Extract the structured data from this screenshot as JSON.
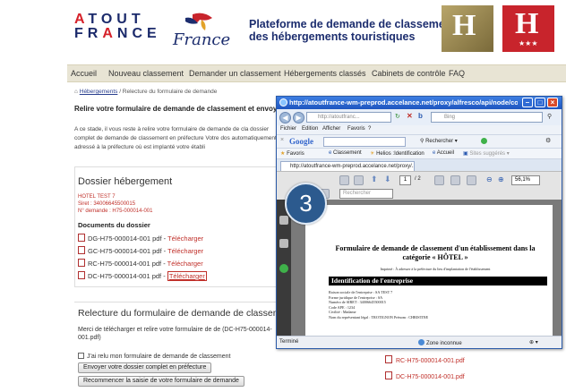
{
  "site": {
    "logo_line1_a": "A",
    "logo_line1_b": "TOUT",
    "logo_line2_a": "FR",
    "logo_line2_b": "A",
    "logo_line2_c": "NCE",
    "logo_script": "France",
    "title_line1": "Plateforme de demande de classement",
    "title_line2": "des hébergements touristiques",
    "badge_letter": "H",
    "badge_stars": "★★★"
  },
  "nav": {
    "items": [
      "Accueil",
      "Nouveau classement",
      "Demander un classement",
      "Hébergements classés",
      "Cabinets de contrôle",
      "FAQ"
    ]
  },
  "breadcrumb": {
    "link": "Hébergements",
    "rest": " / Relecture du formulaire de demande"
  },
  "main": {
    "heading": "Relire votre formulaire de demande de classement et envoyer",
    "intro": "A ce stade, il vous reste à relire votre formulaire de demande de cla dossier complet de demande de classement en préfecture Votre dos automatiquement adressé à la préfecture où est implanté votre établi"
  },
  "dossier": {
    "title": "Dossier hébergement",
    "hotel_name": "HOTEL TEST 7",
    "siret": "Siret : 34006645500015",
    "demande": "N° demande : H75-000014-001",
    "docs_title": "Documents du dossier",
    "documents": [
      {
        "name": "DG-H75-000014-001 pdf - ",
        "action": "Télécharger"
      },
      {
        "name": "GC-H75-000014-001 pdf - ",
        "action": "Télécharger"
      },
      {
        "name": "RC-H75-000014-001 pdf - ",
        "action": "Télécharger"
      },
      {
        "name": "DC-H75-000014-001 pdf - ",
        "action": "Télécharger"
      }
    ]
  },
  "relecture": {
    "title": "Relecture du formulaire de demande de classem",
    "text": "Merci de télécharger et relire votre formulaire de de (DC-H75-000014-001.pdf)",
    "confirm": "J'ai relu mon formulaire de demande de classement",
    "send_button": "Envoyer votre dossier complet en préfecture",
    "restart_button": "Recommencer la saisie de votre formulaire de demande"
  },
  "right_docs": [
    "RC-H75-000014-001.pdf",
    "DC-H75-000014-001.pdf"
  ],
  "popup": {
    "title": "http://atoutfrance-wm-preprod.accelance.net/proxy/alfresco/api/node/conten...",
    "url": "http://atoutfranc...",
    "search_placeholder": "Bing",
    "menu": [
      "Fichier",
      "Edition",
      "Afficher",
      "Favoris",
      "?"
    ],
    "google_label": "Google",
    "google_search": "Rechercher",
    "favorites": [
      "Favoris",
      "Classement",
      "Helios :Identification",
      "Accueil",
      "Sites suggérés"
    ],
    "tab": "http://atoutfrance-wm-preprod.accelance.net/proxy/...",
    "page_current": "1",
    "page_total": "/ 2",
    "zoom": "56,1%",
    "find_placeholder": "Rechercher",
    "status": "Terminé",
    "status_zone": "Zone inconnue",
    "status_zoom": "⊕ ▾"
  },
  "pdf": {
    "title_line1": "Formulaire de demande de classement d'un établissement dans la",
    "title_line2": "catégorie « HÔTEL »",
    "subtitle": "Imprimé : À adresser à la préfecture du lieu d'implantation de l'établissement",
    "section": "Identification de l'entreprise",
    "lines": [
      "Raison sociale de l'entreprise : SA TEST 7",
      "Forme juridique de l'entreprise : SA",
      "Numéro de SIRET : 34006645500015",
      "Code APE : 1234",
      "Civilité : Madame",
      "Nom du représentant légal : TROTIGNON    Prénom : CHRISTINE"
    ]
  },
  "step": "3",
  "colors": {
    "brand_blue": "#1c2d6e",
    "brand_red": "#c8242c",
    "link_red": "#c0302a",
    "badge_blue": "#2c5a8e"
  }
}
